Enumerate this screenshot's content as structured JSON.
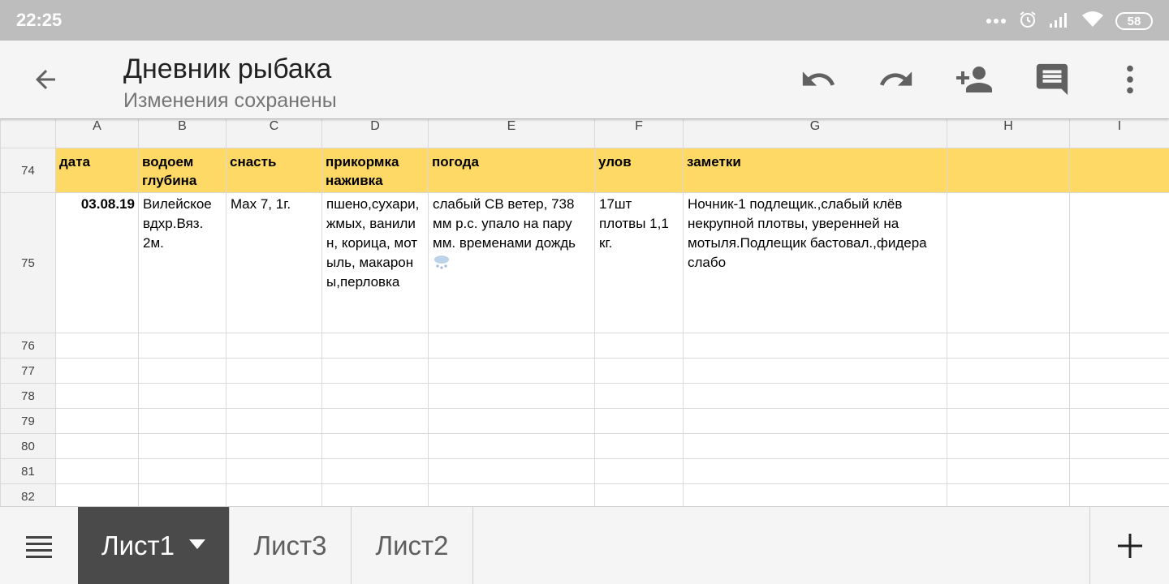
{
  "status_bar": {
    "time": "22:25",
    "battery": "58"
  },
  "app_bar": {
    "title": "Дневник рыбака",
    "subtitle": "Изменения сохранены"
  },
  "sheet": {
    "columns": [
      "A",
      "B",
      "C",
      "D",
      "E",
      "F",
      "G",
      "H",
      "I"
    ],
    "header_row": {
      "number": "74",
      "cells": [
        "дата",
        "водоем глубина",
        "снасть",
        "прикормка наживка",
        "погода",
        "улов",
        "заметки",
        "",
        ""
      ]
    },
    "data_row": {
      "number": "75",
      "date": "03.08.19",
      "waterbody": "Вилейское вдхр.Вяз. 2м.",
      "tackle": "Max 7, 1г.",
      "bait": "пшено,сухари,жмых, ванилин, корица, мотыль, макароны,перловка",
      "weather": "слабый СВ ветер, 738 мм р.с. упало на пару мм. временами дождь",
      "catch": "17шт плотвы 1,1 кг.",
      "notes": "Ночник-1 подлещик.,слабый клёв некрупной плотвы, уверенней на мотыля.Подлещик бастовал.,фидера слабо"
    },
    "empty_rows": [
      "76",
      "77",
      "78",
      "79",
      "80",
      "81",
      "82"
    ]
  },
  "tabs": [
    {
      "label": "Лист1",
      "active": true
    },
    {
      "label": "Лист3",
      "active": false
    },
    {
      "label": "Лист2",
      "active": false
    }
  ],
  "colors": {
    "header_fill": "#ffd966",
    "active_tab": "#4a4a4a",
    "status_bar": "#bdbdbd"
  },
  "icons": [
    "back-arrow-icon",
    "undo-icon",
    "redo-icon",
    "add-person-icon",
    "comment-icon",
    "more-vert-icon",
    "menu-icon",
    "plus-icon",
    "snow-cloud-icon"
  ]
}
